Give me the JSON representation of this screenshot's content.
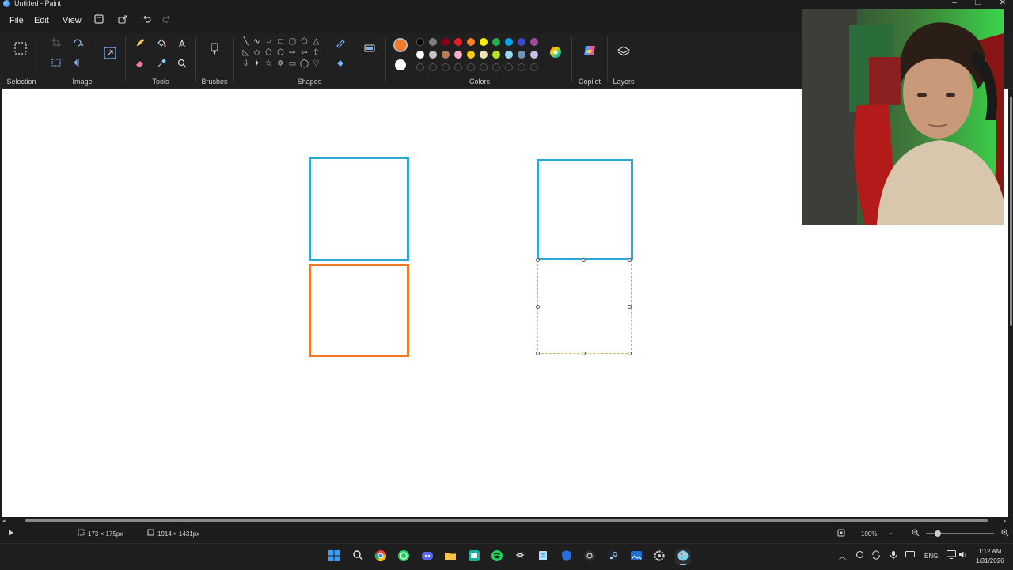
{
  "window": {
    "title": "Untitled - Paint",
    "minimize": "–",
    "maximize": "❐",
    "close": "✕"
  },
  "menu": {
    "file": "File",
    "edit": "Edit",
    "view": "View"
  },
  "ribbon": {
    "selection_label": "Selection",
    "image_label": "Image",
    "tools_label": "Tools",
    "brushes_label": "Brushes",
    "shapes_label": "Shapes",
    "colors_label": "Colors",
    "copilot_label": "Copilot",
    "layers_label": "Layers",
    "text_tool": "A",
    "primary_color": "#f07a2a",
    "secondary_color": "#ffffff",
    "palette_row1": [
      "#000000",
      "#7f7f7f",
      "#880015",
      "#ed1c24",
      "#ff7f27",
      "#fff200",
      "#22b14c",
      "#00a2e8",
      "#3f48cc",
      "#a349a4"
    ],
    "palette_row2": [
      "#ffffff",
      "#c3c3c3",
      "#b97a57",
      "#ffaec9",
      "#ffc90e",
      "#efe4b0",
      "#b5e61d",
      "#99d9ea",
      "#7092be",
      "#c8bfe7"
    ]
  },
  "canvas": {
    "shapes": [
      {
        "name": "blue-square-left",
        "color": "#2aa8d8"
      },
      {
        "name": "orange-square-left",
        "color": "#f07a2a"
      },
      {
        "name": "blue-square-right",
        "color": "#2aa8d8"
      },
      {
        "name": "selection-box-right",
        "color": "#d4b44a"
      }
    ]
  },
  "status": {
    "selection_size": "173 × 175px",
    "canvas_size": "1914 × 1431px",
    "zoom": "100%"
  },
  "taskbar": {
    "language": "ENG",
    "time": "1:12 AM",
    "date": "1/31/2026"
  }
}
